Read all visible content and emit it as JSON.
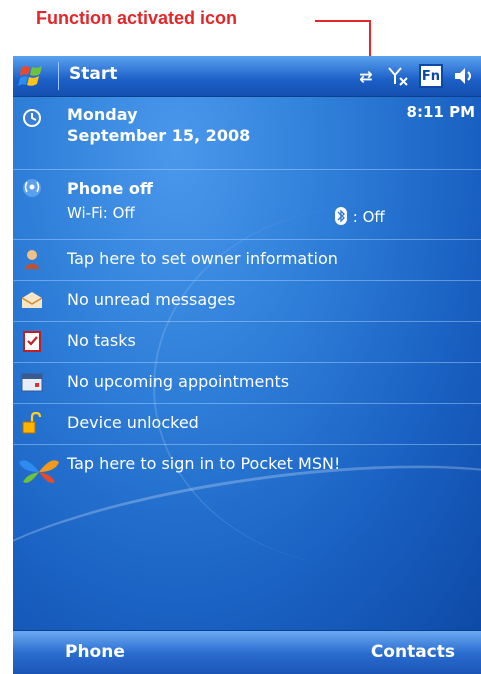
{
  "annotation": {
    "label": "Function activated icon",
    "color": "#e4262a"
  },
  "titlebar": {
    "start_label": "Start",
    "icons": [
      "connectivity-arrows-icon",
      "signal-off-icon",
      "fn-active-icon",
      "speaker-icon"
    ],
    "fn_label": "Fn"
  },
  "today": {
    "date": {
      "day": "Monday",
      "full_date": "September 15, 2008",
      "time": "8:11 PM"
    },
    "phone": {
      "title": "Phone off",
      "wifi": "Wi-Fi: Off",
      "bluetooth": ": Off"
    },
    "items": [
      {
        "label": "Tap here to set owner information",
        "icon": "owner-icon"
      },
      {
        "label": "No unread messages",
        "icon": "envelope-icon"
      },
      {
        "label": "No tasks",
        "icon": "clipboard-icon"
      },
      {
        "label": "No upcoming appointments",
        "icon": "calendar-icon"
      },
      {
        "label": "Device unlocked",
        "icon": "padlock-icon"
      },
      {
        "label": "Tap here to sign in to Pocket MSN!",
        "icon": "msn-butterfly-icon"
      }
    ]
  },
  "softkeys": {
    "left": "Phone",
    "right": "Contacts"
  },
  "colors": {
    "background_blue": "#1a6fcb",
    "text": "#ffffff"
  }
}
